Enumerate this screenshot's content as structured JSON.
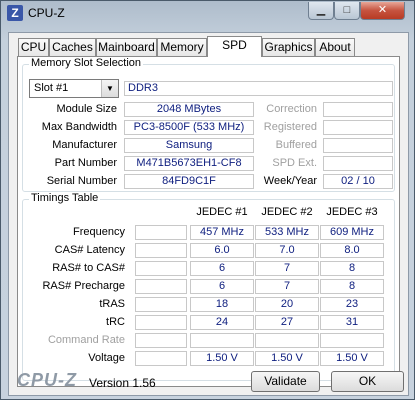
{
  "window": {
    "title": "CPU-Z",
    "icon_letter": "Z"
  },
  "titlebar_buttons": {
    "minimize": "▁",
    "maximize": "□",
    "close": "✕"
  },
  "tabs": [
    {
      "label": "CPU",
      "active": false
    },
    {
      "label": "Caches",
      "active": false
    },
    {
      "label": "Mainboard",
      "active": false
    },
    {
      "label": "Memory",
      "active": false
    },
    {
      "label": "SPD",
      "active": true
    },
    {
      "label": "Graphics",
      "active": false
    },
    {
      "label": "About",
      "active": false
    }
  ],
  "memory_slot": {
    "group_title": "Memory Slot Selection",
    "slot_value": "Slot #1",
    "type": "DDR3",
    "module_size_label": "Module Size",
    "module_size": "2048 MBytes",
    "max_bandwidth_label": "Max Bandwidth",
    "max_bandwidth": "PC3-8500F (533 MHz)",
    "manufacturer_label": "Manufacturer",
    "manufacturer": "Samsung",
    "part_number_label": "Part Number",
    "part_number": "M471B5673EH1-CF8",
    "serial_number_label": "Serial Number",
    "serial_number": "84FD9C1F",
    "correction_label": "Correction",
    "registered_label": "Registered",
    "buffered_label": "Buffered",
    "spd_ext_label": "SPD Ext.",
    "week_year_label": "Week/Year",
    "week_year": "02 / 10"
  },
  "timings": {
    "group_title": "Timings Table",
    "columns": [
      "JEDEC #1",
      "JEDEC #2",
      "JEDEC #3"
    ],
    "rows": [
      {
        "label": "Frequency",
        "values": [
          "457 MHz",
          "533 MHz",
          "609 MHz"
        ],
        "grey": false
      },
      {
        "label": "CAS# Latency",
        "values": [
          "6.0",
          "7.0",
          "8.0"
        ],
        "grey": false
      },
      {
        "label": "RAS# to CAS#",
        "values": [
          "6",
          "7",
          "8"
        ],
        "grey": false
      },
      {
        "label": "RAS# Precharge",
        "values": [
          "6",
          "7",
          "8"
        ],
        "grey": false
      },
      {
        "label": "tRAS",
        "values": [
          "18",
          "20",
          "23"
        ],
        "grey": false
      },
      {
        "label": "tRC",
        "values": [
          "24",
          "27",
          "31"
        ],
        "grey": false
      },
      {
        "label": "Command Rate",
        "values": [
          "",
          "",
          ""
        ],
        "grey": true
      },
      {
        "label": "Voltage",
        "values": [
          "1.50 V",
          "1.50 V",
          "1.50 V"
        ],
        "grey": false
      }
    ]
  },
  "footer": {
    "logo": "CPU-Z",
    "version": "Version 1.56",
    "validate_label": "Validate",
    "ok_label": "OK"
  }
}
